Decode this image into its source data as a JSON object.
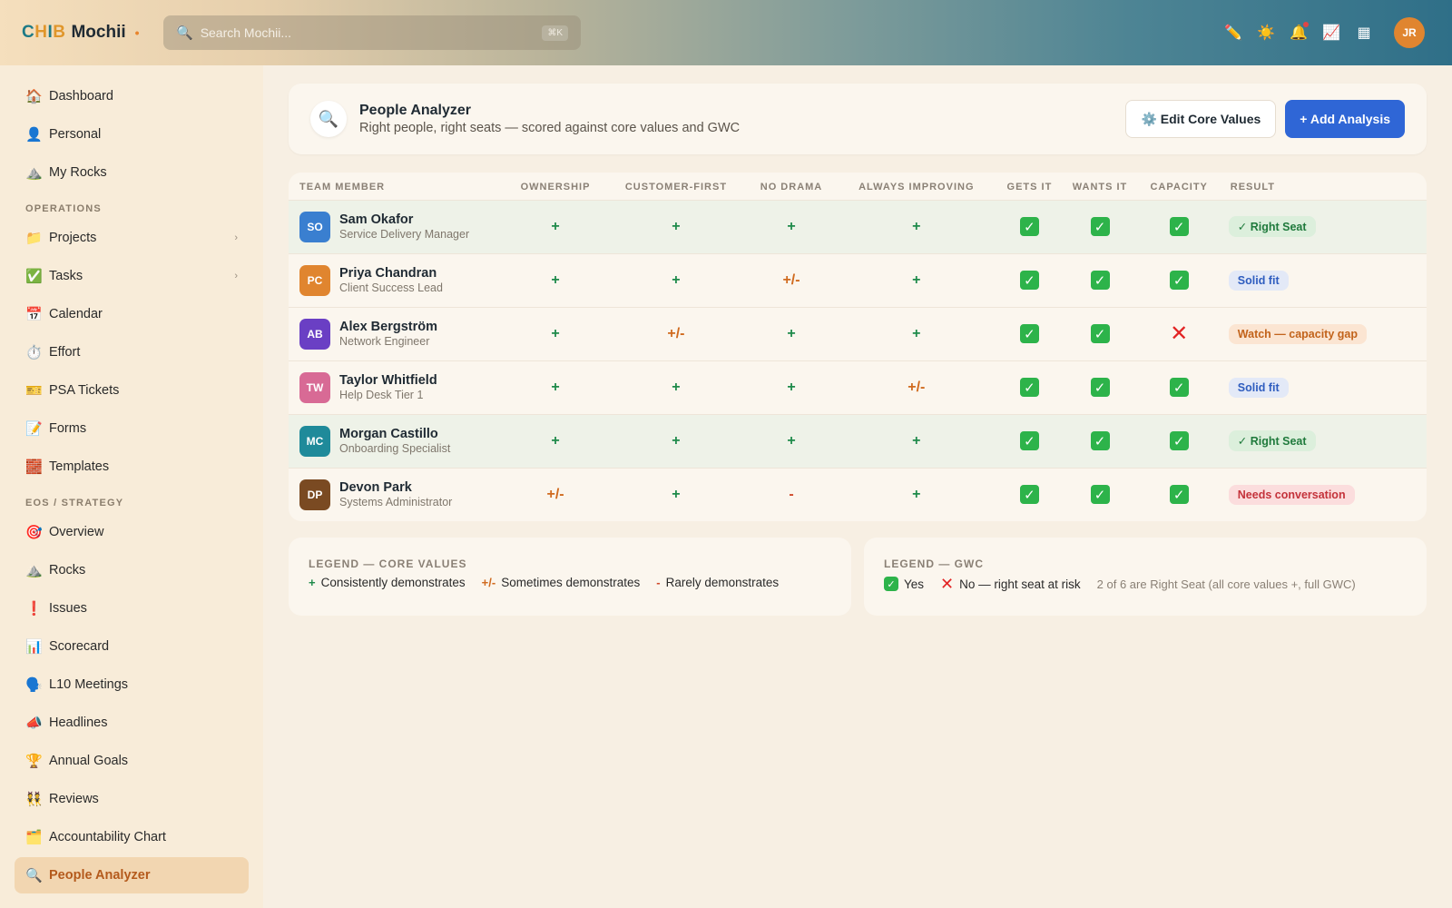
{
  "brand": {
    "mark": [
      "C",
      "H",
      "I",
      "B"
    ],
    "name": "Mochii",
    "dot": "•"
  },
  "search": {
    "placeholder": "Search Mochii...",
    "shortcut": "⌘K"
  },
  "user": {
    "initials": "JR"
  },
  "topbar_icons": [
    "pencil-icon",
    "sun-icon",
    "bell-icon",
    "chart-icon",
    "grid-icon"
  ],
  "sidebar": {
    "top_items": [
      {
        "label": "Dashboard",
        "icon": "🏠"
      },
      {
        "label": "Personal",
        "icon": "👤"
      },
      {
        "label": "My Rocks",
        "icon": "⛰️"
      }
    ],
    "operations_title": "OPERATIONS",
    "operations_items": [
      {
        "label": "Projects",
        "icon": "📁",
        "chevron": "›"
      },
      {
        "label": "Tasks",
        "icon": "✅",
        "chevron": "›"
      },
      {
        "label": "Calendar",
        "icon": "📅"
      },
      {
        "label": "Effort",
        "icon": "⏱️"
      },
      {
        "label": "PSA Tickets",
        "icon": "🎫"
      },
      {
        "label": "Forms",
        "icon": "📝"
      },
      {
        "label": "Templates",
        "icon": "🧱"
      }
    ],
    "eos_title": "EOS / STRATEGY",
    "eos_items": [
      {
        "label": "Overview",
        "icon": "🎯"
      },
      {
        "label": "Rocks",
        "icon": "⛰️"
      },
      {
        "label": "Issues",
        "icon": "❗"
      },
      {
        "label": "Scorecard",
        "icon": "📊"
      },
      {
        "label": "L10 Meetings",
        "icon": "🗣️"
      },
      {
        "label": "Headlines",
        "icon": "📣"
      },
      {
        "label": "Annual Goals",
        "icon": "🏆"
      },
      {
        "label": "Reviews",
        "icon": "👯"
      },
      {
        "label": "Accountability Chart",
        "icon": "🗂️"
      },
      {
        "label": "People Analyzer",
        "icon": "🔍",
        "active": true
      }
    ]
  },
  "header": {
    "icon": "🔍",
    "title": "People Analyzer",
    "subtitle": "Right people, right seats — scored against core values and GWC",
    "edit_button": "⚙️ Edit Core Values",
    "add_button": "+ Add Analysis"
  },
  "table": {
    "columns": [
      "TEAM MEMBER",
      "OWNERSHIP",
      "CUSTOMER-FIRST",
      "NO DRAMA",
      "ALWAYS IMPROVING",
      "GETS IT",
      "WANTS IT",
      "CAPACITY",
      "RESULT"
    ],
    "rows": [
      {
        "initials": "SO",
        "color": "#3a7fd0",
        "name": "Sam Okafor",
        "role": "Service Delivery Manager",
        "values": [
          "+",
          "+",
          "+",
          "+"
        ],
        "gwc": [
          "yes",
          "yes",
          "yes"
        ],
        "result": "✓ Right Seat",
        "result_type": "right"
      },
      {
        "initials": "PC",
        "color": "#e0852f",
        "name": "Priya Chandran",
        "role": "Client Success Lead",
        "values": [
          "+",
          "+",
          "+/-",
          "+"
        ],
        "gwc": [
          "yes",
          "yes",
          "yes"
        ],
        "result": "Solid fit",
        "result_type": "solid"
      },
      {
        "initials": "AB",
        "color": "#6a3fc4",
        "name": "Alex Bergström",
        "role": "Network Engineer",
        "values": [
          "+",
          "+/-",
          "+",
          "+"
        ],
        "gwc": [
          "yes",
          "yes",
          "no"
        ],
        "result": "Watch — capacity gap",
        "result_type": "watch"
      },
      {
        "initials": "TW",
        "color": "#d86a95",
        "name": "Taylor Whitfield",
        "role": "Help Desk Tier 1",
        "values": [
          "+",
          "+",
          "+",
          "+/-"
        ],
        "gwc": [
          "yes",
          "yes",
          "yes"
        ],
        "result": "Solid fit",
        "result_type": "solid"
      },
      {
        "initials": "MC",
        "color": "#1f8a9a",
        "name": "Morgan Castillo",
        "role": "Onboarding Specialist",
        "values": [
          "+",
          "+",
          "+",
          "+"
        ],
        "gwc": [
          "yes",
          "yes",
          "yes"
        ],
        "result": "✓ Right Seat",
        "result_type": "right"
      },
      {
        "initials": "DP",
        "color": "#7a4a22",
        "name": "Devon Park",
        "role": "Systems Administrator",
        "values": [
          "+/-",
          "+",
          "-",
          "+"
        ],
        "gwc": [
          "yes",
          "yes",
          "yes"
        ],
        "result": "Needs conversation",
        "result_type": "needs"
      }
    ]
  },
  "legend_core": {
    "title": "LEGEND — CORE VALUES",
    "items": [
      {
        "symbol": "+",
        "label": "Consistently demonstrates"
      },
      {
        "symbol": "+/-",
        "label": "Sometimes demonstrates"
      },
      {
        "symbol": "-",
        "label": "Rarely demonstrates"
      }
    ]
  },
  "legend_gwc": {
    "title": "LEGEND — GWC",
    "yes_label": "Yes",
    "no_label": "No — right seat at risk",
    "note": "2 of 6 are Right Seat (all core values +, full GWC)"
  }
}
